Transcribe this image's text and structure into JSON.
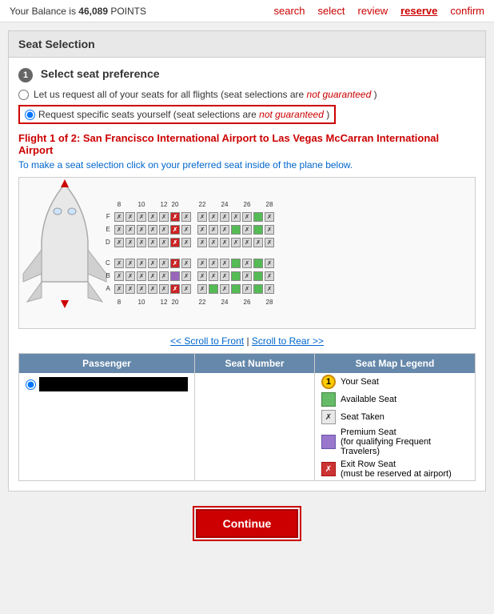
{
  "header": {
    "balance_label": "Your Balance is",
    "balance_amount": "46,089",
    "balance_unit": "POINTS"
  },
  "nav": {
    "steps": [
      {
        "label": "search",
        "state": "inactive"
      },
      {
        "label": "select",
        "state": "inactive"
      },
      {
        "label": "review",
        "state": "inactive"
      },
      {
        "label": "reserve",
        "state": "active"
      },
      {
        "label": "confirm",
        "state": "inactive"
      }
    ]
  },
  "page": {
    "section_title": "Seat Selection",
    "step_number": "1",
    "step_label": "Select seat preference",
    "option1_text": "Let us request all of your seats for all flights (seat selections are",
    "option1_not_guaranteed": "not guaranteed",
    "option1_end": ")",
    "option2_text": "Request specific seats yourself (seat selections are",
    "option2_not_guaranteed": "not guaranteed",
    "option2_end": ")",
    "flight_title": "Flight 1 of 2: San Francisco International Airport to Las Vegas McCarran International Airport",
    "seat_instruction": "To make a seat selection click on your preferred seat inside of the plane below.",
    "scroll_front": "<< Scroll to Front",
    "scroll_separator": "|",
    "scroll_rear": "Scroll to Rear >>",
    "passenger_header": "Passenger",
    "seat_number_header": "Seat Number",
    "legend_header": "Seat Map Legend",
    "legend": [
      {
        "icon": "1",
        "type": "your-seat",
        "label": "Your Seat"
      },
      {
        "icon": "G",
        "type": "available",
        "label": "Available Seat"
      },
      {
        "icon": "X",
        "type": "taken",
        "label": "Seat Taken"
      },
      {
        "icon": "P",
        "type": "premium",
        "label": "Premium Seat\n(for qualifying Frequent Travelers)"
      },
      {
        "icon": "E",
        "type": "exit",
        "label": "Exit Row Seat\n(must be reserved at airport)"
      }
    ],
    "continue_button": "Continue"
  }
}
